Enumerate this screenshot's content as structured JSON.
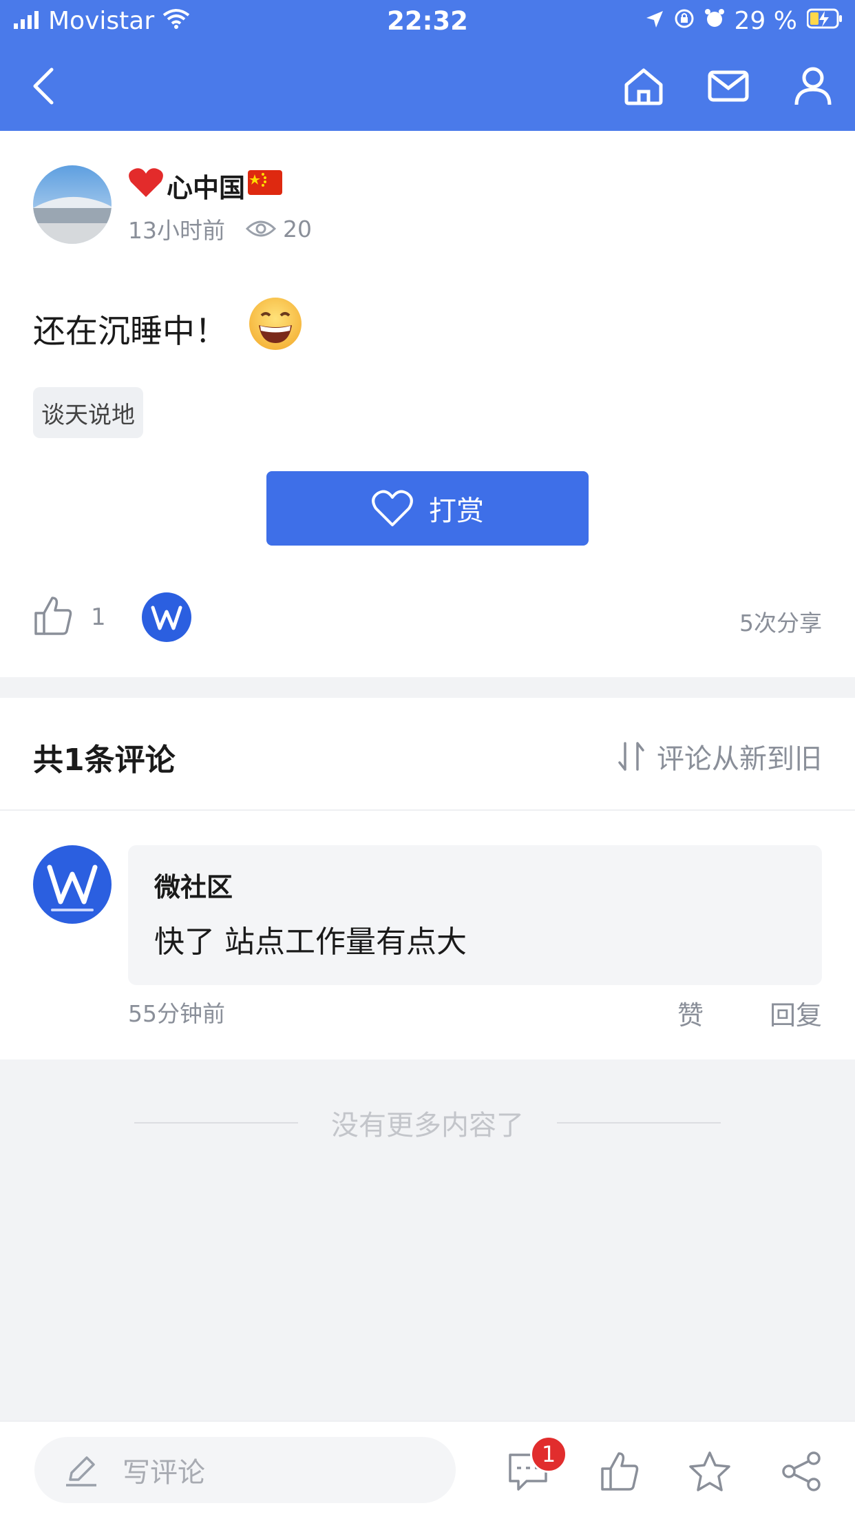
{
  "status_bar": {
    "carrier": "Movistar",
    "time": "22:32",
    "battery": "29 %"
  },
  "nav": {
    "back_icon": "back-chevron-icon",
    "home_icon": "home-icon",
    "mail_icon": "mail-icon",
    "user_icon": "user-icon"
  },
  "post": {
    "author": "心中国",
    "time_ago": "13小时前",
    "views": "20",
    "content": "还在沉睡中！",
    "tag": "谈天说地",
    "reward_label": "打赏",
    "likes": "1",
    "shares": "5次分享"
  },
  "comments": {
    "header": "共1条评论",
    "sort_label": "评论从新到旧",
    "items": [
      {
        "author": "微社区",
        "text": "快了 站点工作量有点大",
        "time": "55分钟前",
        "like_label": "赞",
        "reply_label": "回复"
      }
    ]
  },
  "footer": {
    "no_more": "没有更多内容了"
  },
  "bottom_bar": {
    "write_placeholder": "写评论",
    "comment_badge": "1"
  },
  "colors": {
    "primary": "#4a7aea",
    "button": "#3e6fe8",
    "badge": "#e12d2d"
  }
}
